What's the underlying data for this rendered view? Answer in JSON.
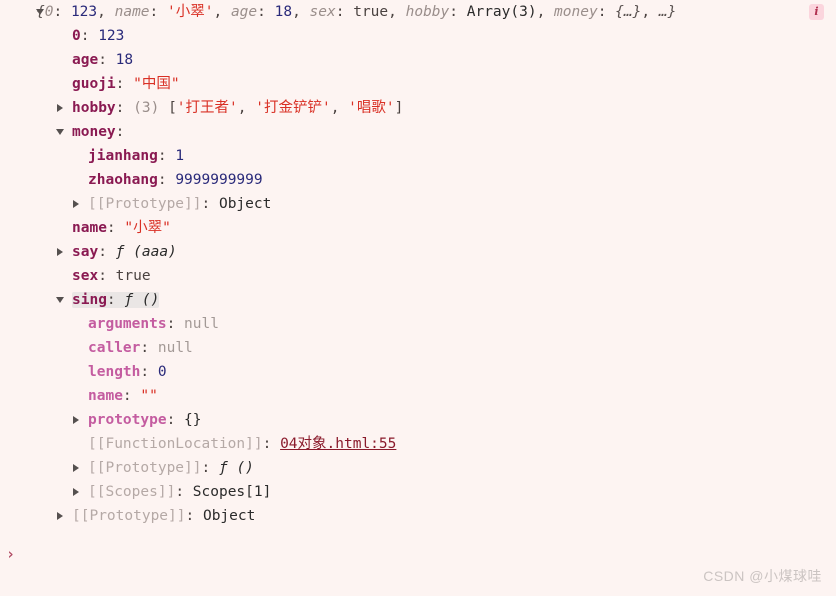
{
  "console": {
    "background_color": "#fdf4f2",
    "prompt_symbol": "›",
    "prompt_value": "",
    "prompt_placeholder": "",
    "info_badge_label": "i"
  },
  "watermark": "CSDN @小煤球哇",
  "rows": [
    {
      "name": "object-preview-header",
      "indent": "lvl0",
      "triangle": "open",
      "segments": [
        {
          "cls": "preview-brace",
          "text": "{"
        },
        {
          "cls": "k-preview",
          "text": "0"
        },
        {
          "cls": "punct",
          "text": ": "
        },
        {
          "cls": "v-num",
          "text": "123"
        },
        {
          "cls": "punct",
          "text": ", "
        },
        {
          "cls": "k-preview",
          "text": "name"
        },
        {
          "cls": "punct",
          "text": ": "
        },
        {
          "cls": "v-str",
          "text": "'小翠'"
        },
        {
          "cls": "punct",
          "text": ", "
        },
        {
          "cls": "k-preview",
          "text": "age"
        },
        {
          "cls": "punct",
          "text": ": "
        },
        {
          "cls": "v-num",
          "text": "18"
        },
        {
          "cls": "punct",
          "text": ", "
        },
        {
          "cls": "k-preview",
          "text": "sex"
        },
        {
          "cls": "punct",
          "text": ": "
        },
        {
          "cls": "v-bool",
          "text": "true"
        },
        {
          "cls": "punct",
          "text": ", "
        },
        {
          "cls": "k-preview",
          "text": "hobby"
        },
        {
          "cls": "punct",
          "text": ": "
        },
        {
          "cls": "v-obj",
          "text": "Array(3)"
        },
        {
          "cls": "punct",
          "text": ", "
        },
        {
          "cls": "k-preview",
          "text": "money"
        },
        {
          "cls": "punct",
          "text": ": "
        },
        {
          "cls": "preview-brace",
          "text": "{…}"
        },
        {
          "cls": "punct",
          "text": ", "
        },
        {
          "cls": "preview-brace",
          "text": "…}"
        }
      ]
    },
    {
      "name": "property-0",
      "indent": "lvl1",
      "triangle": "none",
      "segments": [
        {
          "cls": "k-own",
          "text": "0"
        },
        {
          "cls": "punct",
          "text": ": "
        },
        {
          "cls": "v-num",
          "text": "123"
        }
      ]
    },
    {
      "name": "property-age",
      "indent": "lvl1",
      "triangle": "none",
      "segments": [
        {
          "cls": "k-own",
          "text": "age"
        },
        {
          "cls": "punct",
          "text": ": "
        },
        {
          "cls": "v-num",
          "text": "18"
        }
      ]
    },
    {
      "name": "property-guoji",
      "indent": "lvl1",
      "triangle": "none",
      "segments": [
        {
          "cls": "k-own",
          "text": "guoji"
        },
        {
          "cls": "punct",
          "text": ": "
        },
        {
          "cls": "v-str",
          "text": "\"中国\""
        }
      ]
    },
    {
      "name": "property-hobby",
      "indent": "lvl1",
      "triangle": "closed",
      "segments": [
        {
          "cls": "k-own",
          "text": "hobby"
        },
        {
          "cls": "punct",
          "text": ": "
        },
        {
          "cls": "v-count",
          "text": "(3)"
        },
        {
          "cls": "punct",
          "text": " "
        },
        {
          "cls": "punct",
          "text": "["
        },
        {
          "cls": "v-str",
          "text": "'打王者'"
        },
        {
          "cls": "punct",
          "text": ", "
        },
        {
          "cls": "v-str",
          "text": "'打金铲铲'"
        },
        {
          "cls": "punct",
          "text": ", "
        },
        {
          "cls": "v-str",
          "text": "'唱歌'"
        },
        {
          "cls": "punct",
          "text": "]"
        }
      ]
    },
    {
      "name": "property-money",
      "indent": "lvl1",
      "triangle": "open",
      "segments": [
        {
          "cls": "k-own",
          "text": "money"
        },
        {
          "cls": "punct",
          "text": ":"
        }
      ]
    },
    {
      "name": "property-money-jianhang",
      "indent": "lvl2",
      "triangle": "none",
      "segments": [
        {
          "cls": "k-own",
          "text": "jianhang"
        },
        {
          "cls": "punct",
          "text": ": "
        },
        {
          "cls": "v-num",
          "text": "1"
        }
      ]
    },
    {
      "name": "property-money-zhaohang",
      "indent": "lvl2",
      "triangle": "none",
      "segments": [
        {
          "cls": "k-own",
          "text": "zhaohang"
        },
        {
          "cls": "punct",
          "text": ": "
        },
        {
          "cls": "v-num",
          "text": "9999999999"
        }
      ]
    },
    {
      "name": "property-money-prototype",
      "indent": "lvl2",
      "triangle": "closed",
      "segments": [
        {
          "cls": "k-internal",
          "text": "[[Prototype]]"
        },
        {
          "cls": "punct",
          "text": ": "
        },
        {
          "cls": "v-obj",
          "text": "Object"
        }
      ]
    },
    {
      "name": "property-name",
      "indent": "lvl1",
      "triangle": "none",
      "segments": [
        {
          "cls": "k-own",
          "text": "name"
        },
        {
          "cls": "punct",
          "text": ": "
        },
        {
          "cls": "v-str",
          "text": "\"小翠\""
        }
      ]
    },
    {
      "name": "property-say",
      "indent": "lvl1",
      "triangle": "closed",
      "segments": [
        {
          "cls": "k-own",
          "text": "say"
        },
        {
          "cls": "punct",
          "text": ": "
        },
        {
          "cls": "fn-sym",
          "text": "ƒ "
        },
        {
          "cls": "v-fn",
          "text": "(aaa)"
        }
      ]
    },
    {
      "name": "property-sex",
      "indent": "lvl1",
      "triangle": "none",
      "segments": [
        {
          "cls": "k-own",
          "text": "sex"
        },
        {
          "cls": "punct",
          "text": ": "
        },
        {
          "cls": "v-bool",
          "text": "true"
        }
      ]
    },
    {
      "name": "property-sing",
      "indent": "lvl1",
      "triangle": "open",
      "highlight": true,
      "segments": [
        {
          "cls": "k-own",
          "text": "sing"
        },
        {
          "cls": "punct",
          "text": ": "
        },
        {
          "cls": "fn-sym",
          "text": "ƒ "
        },
        {
          "cls": "v-fn",
          "text": "()"
        }
      ]
    },
    {
      "name": "property-sing-arguments",
      "indent": "lvl2",
      "triangle": "none",
      "segments": [
        {
          "cls": "k-proto",
          "text": "arguments"
        },
        {
          "cls": "punct",
          "text": ": "
        },
        {
          "cls": "v-null",
          "text": "null"
        }
      ]
    },
    {
      "name": "property-sing-caller",
      "indent": "lvl2",
      "triangle": "none",
      "segments": [
        {
          "cls": "k-proto",
          "text": "caller"
        },
        {
          "cls": "punct",
          "text": ": "
        },
        {
          "cls": "v-null",
          "text": "null"
        }
      ]
    },
    {
      "name": "property-sing-length",
      "indent": "lvl2",
      "triangle": "none",
      "segments": [
        {
          "cls": "k-proto",
          "text": "length"
        },
        {
          "cls": "punct",
          "text": ": "
        },
        {
          "cls": "v-num",
          "text": "0"
        }
      ]
    },
    {
      "name": "property-sing-name",
      "indent": "lvl2",
      "triangle": "none",
      "segments": [
        {
          "cls": "k-proto",
          "text": "name"
        },
        {
          "cls": "punct",
          "text": ": "
        },
        {
          "cls": "v-str",
          "text": "\"\""
        }
      ]
    },
    {
      "name": "property-sing-prototype",
      "indent": "lvl2",
      "triangle": "closed",
      "segments": [
        {
          "cls": "k-proto",
          "text": "prototype"
        },
        {
          "cls": "punct",
          "text": ": "
        },
        {
          "cls": "v-obj",
          "text": "{}"
        }
      ]
    },
    {
      "name": "property-sing-function-location",
      "indent": "lvl2",
      "triangle": "none",
      "segments": [
        {
          "cls": "k-internal",
          "text": "[[FunctionLocation]]"
        },
        {
          "cls": "punct",
          "text": ": "
        },
        {
          "cls": "v-link",
          "text": "04对象.html:55"
        }
      ]
    },
    {
      "name": "property-sing-internal-prototype",
      "indent": "lvl2",
      "triangle": "closed",
      "segments": [
        {
          "cls": "k-internal",
          "text": "[[Prototype]]"
        },
        {
          "cls": "punct",
          "text": ": "
        },
        {
          "cls": "fn-sym",
          "text": "ƒ "
        },
        {
          "cls": "v-fn",
          "text": "()"
        }
      ]
    },
    {
      "name": "property-sing-scopes",
      "indent": "lvl2",
      "triangle": "closed",
      "segments": [
        {
          "cls": "k-internal",
          "text": "[[Scopes]]"
        },
        {
          "cls": "punct",
          "text": ": "
        },
        {
          "cls": "v-obj",
          "text": "Scopes[1]"
        }
      ]
    },
    {
      "name": "property-root-prototype",
      "indent": "lvl1",
      "triangle": "closed",
      "segments": [
        {
          "cls": "k-internal",
          "text": "[[Prototype]]"
        },
        {
          "cls": "punct",
          "text": ": "
        },
        {
          "cls": "v-obj",
          "text": "Object"
        }
      ]
    }
  ]
}
